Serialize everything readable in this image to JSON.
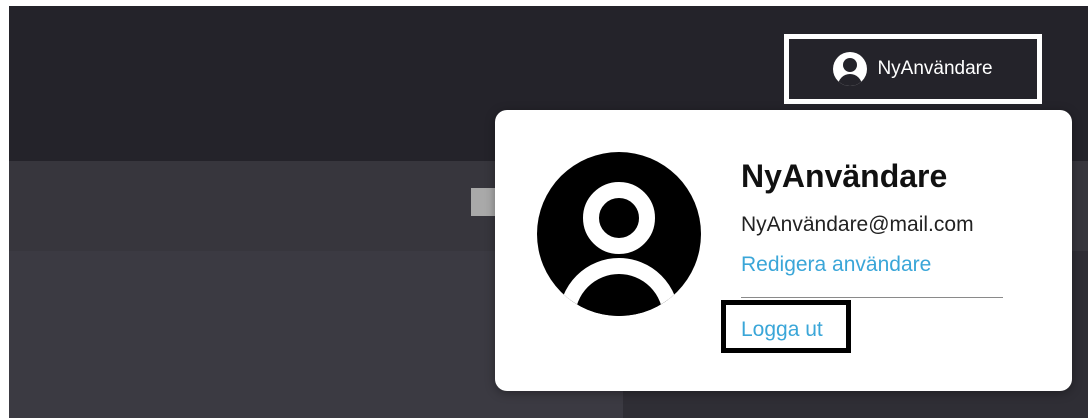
{
  "header": {
    "user_menu": {
      "name": "NyAnvändare",
      "icon": "user-circle-icon"
    }
  },
  "user_popover": {
    "avatar_icon": "user-circle-icon",
    "username": "NyAnvändare",
    "email": "NyAnvändare@mail.com",
    "edit_label": "Redigera användare",
    "logout_label": "Logga ut"
  },
  "colors": {
    "header_bg": "#24232a",
    "link": "#3aa6d8",
    "popover_bg": "#ffffff"
  }
}
